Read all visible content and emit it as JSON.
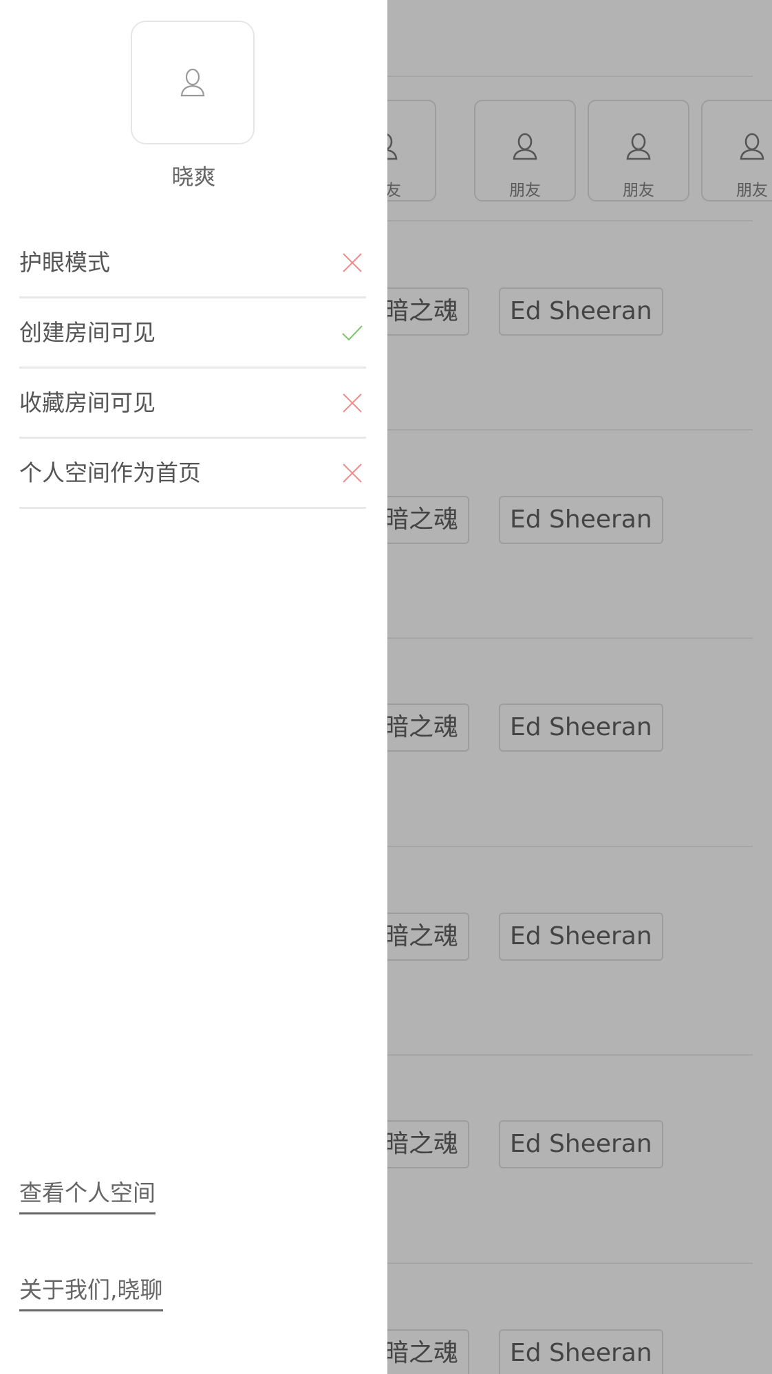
{
  "drawer": {
    "avatar_icon": "user-icon",
    "username": "晓爽",
    "settings": [
      {
        "label": "护眼模式",
        "enabled": false
      },
      {
        "label": "创建房间可见",
        "enabled": true
      },
      {
        "label": "收藏房间可见",
        "enabled": false
      },
      {
        "label": "个人空间作为首页",
        "enabled": false
      }
    ],
    "links": {
      "view_space": "查看个人空间",
      "about": "关于我们,晓聊"
    }
  },
  "background": {
    "friends": [
      {
        "label": "朋友",
        "icon": "user-icon"
      },
      {
        "label": "朋友",
        "icon": "user-icon"
      },
      {
        "label": "朋友",
        "icon": "user-icon"
      },
      {
        "label": "朋友",
        "icon": "user-icon"
      }
    ],
    "rooms": [
      {
        "tags": [
          "黑暗之魂",
          "Ed Sheeran"
        ]
      },
      {
        "tags": [
          "黑暗之魂",
          "Ed Sheeran"
        ]
      },
      {
        "tags": [
          "黑暗之魂",
          "Ed Sheeran"
        ]
      },
      {
        "tags": [
          "黑暗之魂",
          "Ed Sheeran"
        ]
      },
      {
        "tags": [
          "黑暗之魂",
          "Ed Sheeran"
        ]
      },
      {
        "tags": [
          "黑暗之魂",
          "Ed Sheeran"
        ]
      }
    ]
  },
  "colors": {
    "overlay": "#b3b3b3",
    "check": "#7cc46a",
    "cross": "#f08a8a"
  }
}
